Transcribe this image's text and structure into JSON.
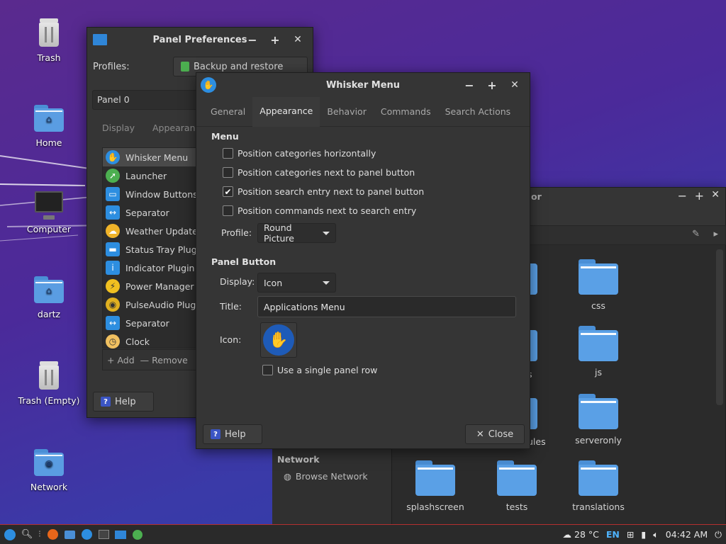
{
  "desktop": {
    "icons": [
      {
        "label": "Trash"
      },
      {
        "label": "Home"
      },
      {
        "label": "Computer"
      },
      {
        "label": "dartz"
      },
      {
        "label": "Trash (Empty)"
      },
      {
        "label": "Network"
      }
    ]
  },
  "panel_prefs": {
    "title": "Panel Preferences",
    "profiles_label": "Profiles:",
    "backup_label": "Backup and restore",
    "panel_select": "Panel 0",
    "tabs": [
      "Display",
      "Appearance"
    ],
    "items": [
      {
        "label": "Whisker Menu",
        "icon": "whisker-icon"
      },
      {
        "label": "Launcher",
        "icon": "launcher-icon"
      },
      {
        "label": "Window Buttons",
        "icon": "window-buttons-icon"
      },
      {
        "label": "Separator",
        "icon": "separator-icon"
      },
      {
        "label": "Weather Update",
        "icon": "weather-icon"
      },
      {
        "label": "Status Tray Plugin",
        "icon": "status-tray-icon"
      },
      {
        "label": "Indicator Plugin",
        "icon": "indicator-icon"
      },
      {
        "label": "Power Manager P",
        "icon": "power-icon"
      },
      {
        "label": "PulseAudio Plugin",
        "icon": "pulseaudio-icon"
      },
      {
        "label": "Separator",
        "icon": "separator-icon"
      },
      {
        "label": "Clock",
        "icon": "clock-icon"
      }
    ],
    "add_label": "Add",
    "remove_label": "Remove",
    "help_label": "Help"
  },
  "whisker": {
    "title": "Whisker Menu",
    "tabs": [
      "General",
      "Appearance",
      "Behavior",
      "Commands",
      "Search Actions"
    ],
    "active_tab": "Appearance",
    "menu_heading": "Menu",
    "options": [
      {
        "label": "Position categories horizontally",
        "checked": false
      },
      {
        "label": "Position categories next to panel button",
        "checked": false
      },
      {
        "label": "Position search entry next to panel button",
        "checked": true
      },
      {
        "label": "Position commands next to search entry",
        "checked": false
      }
    ],
    "profile_label": "Profile:",
    "profile_value": "Round Picture",
    "panel_heading": "Panel Button",
    "display_label": "Display:",
    "display_value": "Icon",
    "title_label": "Title:",
    "title_value": "Applications Menu",
    "icon_label": "Icon:",
    "single_row_label": "Use a single panel row",
    "single_row_checked": false,
    "help_label": "Help",
    "close_label": "Close"
  },
  "file_manager": {
    "title_fragment": "or",
    "folders": [
      {
        "label": "css"
      },
      {
        "label": "s"
      },
      {
        "label": "js"
      },
      {
        "label": "ules"
      },
      {
        "label": "serveronly"
      },
      {
        "label": "splashscreen"
      },
      {
        "label": "tests"
      },
      {
        "label": "translations"
      }
    ],
    "sidebar_heading": "Network",
    "browse_network": "Browse Network"
  },
  "taskbar": {
    "temperature": "28 °C",
    "language": "EN",
    "time": "04:42 AM"
  },
  "colors": {
    "accent_blue": "#2d8ee0",
    "taskbar_border": "#b43030"
  }
}
